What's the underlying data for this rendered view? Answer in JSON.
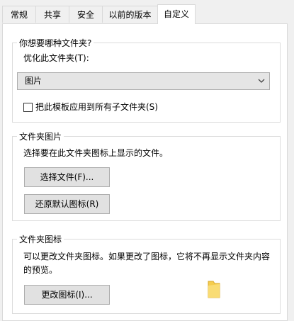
{
  "tabs": [
    {
      "label": "常规"
    },
    {
      "label": "共享"
    },
    {
      "label": "安全"
    },
    {
      "label": "以前的版本"
    },
    {
      "label": "自定义",
      "active": true
    }
  ],
  "optimize_group": {
    "legend": "你想要哪种文件夹?",
    "optimize_label": "优化此文件夹(T):",
    "selected_type": "图片",
    "apply_subfolders_label": "把此模板应用到所有子文件夹(S)",
    "apply_subfolders_checked": false
  },
  "picture_group": {
    "legend": "文件夹图片",
    "description": "选择要在此文件夹图标上显示的文件。",
    "choose_file_button": "选择文件(F)...",
    "restore_default_button": "还原默认图标(R)"
  },
  "icon_group": {
    "legend": "文件夹图标",
    "description_line1": "可以更改文件夹图标。如果更改了图标，它将不再显示文件夹内容",
    "description_line2": "的预览。",
    "change_icon_button": "更改图标(I)..."
  },
  "icons": {
    "dropdown": "chevron-down-icon",
    "preview": "folder-icon"
  },
  "colors": {
    "folder": "#f5cd4f",
    "panel": "#ffffff",
    "window": "#f0f0f0"
  }
}
